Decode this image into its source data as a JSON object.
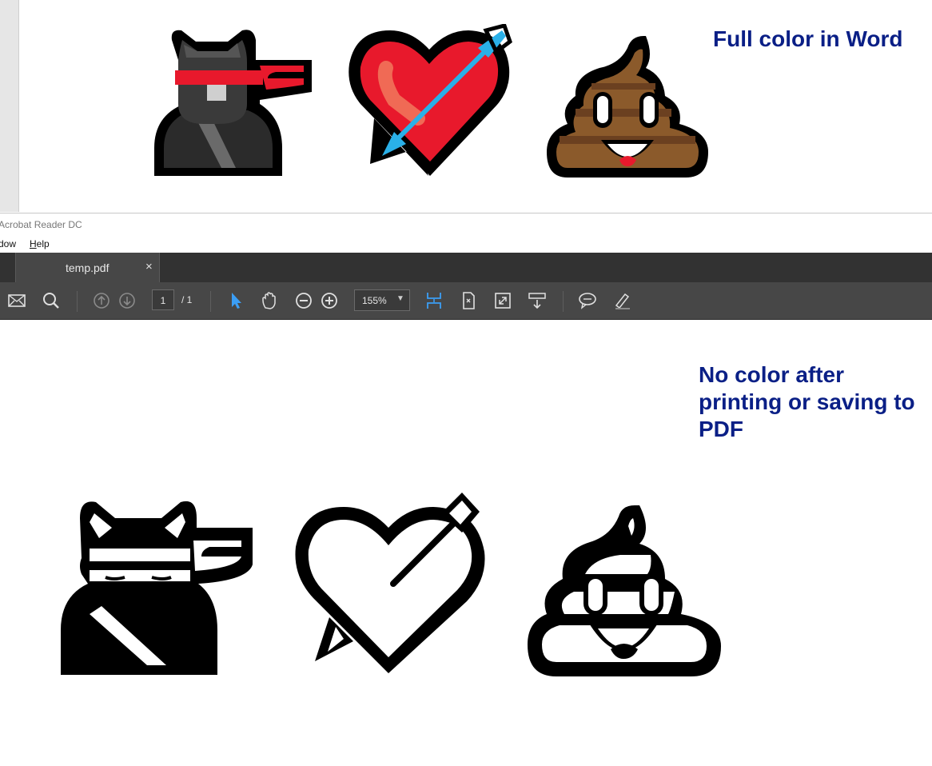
{
  "word": {
    "caption": "Full color in Word"
  },
  "acrobat": {
    "window_title": "Acrobat Reader DC",
    "menu": [
      "dow",
      "Help"
    ],
    "tab": {
      "label": "temp.pdf",
      "close": "×"
    },
    "toolbar": {
      "current_page": "1",
      "page_total": "/ 1",
      "zoom": "155%"
    }
  },
  "pdf": {
    "caption": "No color after printing or saving to PDF"
  },
  "icons": {
    "ninja": "ninja-cat-emoji-icon",
    "heart": "heart-with-arrow-emoji-icon",
    "poo": "pile-of-poo-emoji-icon"
  },
  "colors": {
    "caption": "#0a1f86",
    "headband": "#e8192c",
    "heart": "#e8192c",
    "arrow": "#2ab0e8",
    "poo": "#8b5a2b",
    "toolbar": "#474747",
    "tabbar": "#323232",
    "accent_blue": "#3b9ef5"
  }
}
